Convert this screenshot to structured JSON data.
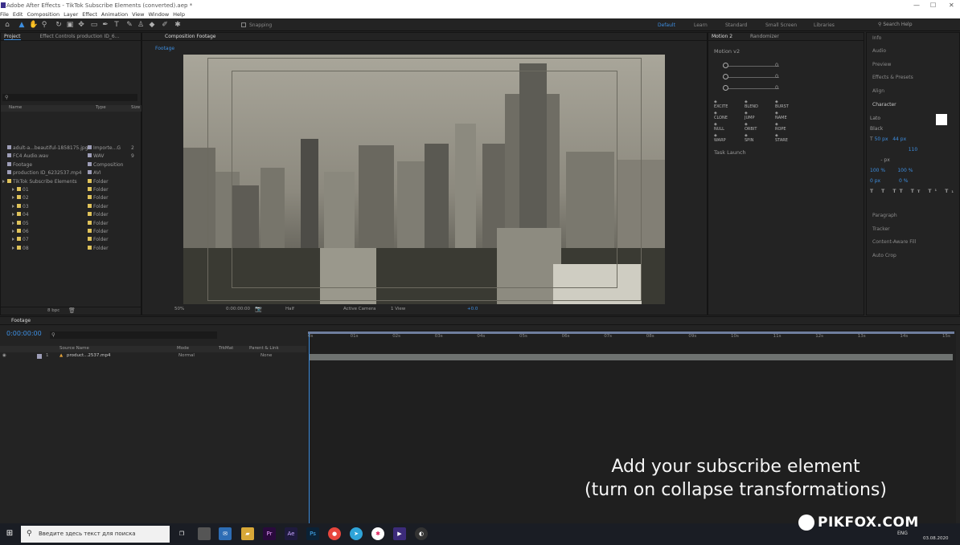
{
  "window": {
    "title": "Adobe After Effects - TikTok Subscribe Elements (converted).aep *"
  },
  "menu": [
    "File",
    "Edit",
    "Composition",
    "Layer",
    "Effect",
    "Animation",
    "View",
    "Window",
    "Help"
  ],
  "toolbar": {
    "snapping": "Snapping",
    "search_help": "Search Help",
    "workspaces": [
      "Default",
      "Learn",
      "Standard",
      "Small Screen",
      "Libraries"
    ]
  },
  "project": {
    "tab": "Project",
    "effect_controls": "Effect Controls production ID_6…",
    "search_placeholder": "",
    "columns": {
      "name": "Name",
      "type": "Type",
      "size": "Size"
    },
    "items": [
      {
        "name": "adult-a...beautiful-1858175.jpg",
        "type": "Importe...G",
        "size": "2",
        "color": "#9e9eb8"
      },
      {
        "name": "FC4 Audio.wav",
        "type": "WAV",
        "size": "9",
        "color": "#9e9eb8"
      },
      {
        "name": "Footage",
        "type": "Composition",
        "size": "",
        "color": "#9e9eb8"
      },
      {
        "name": "production ID_6232537.mp4",
        "type": "AVI",
        "size": "",
        "color": "#9e9eb8"
      },
      {
        "name": "TikTok Subscribe Elements",
        "type": "Folder",
        "size": "",
        "color": "#e0c35a"
      },
      {
        "name": "01",
        "type": "Folder",
        "size": "",
        "color": "#e0c35a"
      },
      {
        "name": "02",
        "type": "Folder",
        "size": "",
        "color": "#e0c35a"
      },
      {
        "name": "03",
        "type": "Folder",
        "size": "",
        "color": "#e0c35a"
      },
      {
        "name": "04",
        "type": "Folder",
        "size": "",
        "color": "#e0c35a"
      },
      {
        "name": "05",
        "type": "Folder",
        "size": "",
        "color": "#e0c35a"
      },
      {
        "name": "06",
        "type": "Folder",
        "size": "",
        "color": "#e0c35a"
      },
      {
        "name": "07",
        "type": "Folder",
        "size": "",
        "color": "#e0c35a"
      },
      {
        "name": "08",
        "type": "Folder",
        "size": "",
        "color": "#e0c35a"
      }
    ],
    "bpc": "8 bpc"
  },
  "composition": {
    "tab": "Composition Footage",
    "subtab": "Footage",
    "zoom": "50%",
    "timecode": "0:00:00:00",
    "resolution": "Half",
    "camera": "Active Camera",
    "views": "1 View",
    "exposure": "+0.0"
  },
  "motion": {
    "tabs": [
      "Motion 2",
      "Randomizer"
    ],
    "preset": "Motion v2",
    "sliders": [
      "0",
      "0",
      "0"
    ],
    "buttons": [
      "EXCITE",
      "BLEND",
      "BURST",
      "CLONE",
      "JUMP",
      "NAME",
      "NULL",
      "ORBIT",
      "ROPE",
      "WARP",
      "SPIN",
      "STARE"
    ],
    "task": "Task Launch"
  },
  "right_panels": {
    "top": [
      "Info",
      "Audio",
      "Preview",
      "Effects & Presets",
      "Align",
      "Character"
    ],
    "char": {
      "font": "Lato",
      "style": "Black",
      "size": "50 px",
      "leading": "44 px",
      "tracking": "110",
      "scale_v": "100 %",
      "scale_h": "100 %",
      "baseline": "0 px",
      "tsume": "0 %",
      "unit": "- px"
    },
    "bottom": [
      "Paragraph",
      "Tracker",
      "Content-Aware Fill",
      "Auto Crop"
    ]
  },
  "timeline": {
    "tab": "Footage",
    "timecode": "0:00:00:00",
    "columns": {
      "source": "Source Name",
      "mode": "Mode",
      "trkmat": "TrkMat",
      "parent": "Parent & Link"
    },
    "layer": {
      "num": "1",
      "name": "product...2537.mp4",
      "mode": "Normal",
      "parent": "None"
    },
    "ruler": [
      "0s",
      "01s",
      "02s",
      "03s",
      "04s",
      "05s",
      "06s",
      "07s",
      "08s",
      "09s",
      "10s",
      "11s",
      "12s",
      "13s",
      "14s",
      "15s"
    ]
  },
  "overlay": {
    "line1": "Add your subscribe element",
    "line2": "(turn on collapse transformations)"
  },
  "watermark": "PIKFOX.COM",
  "taskbar": {
    "search": "Введите здесь текст для поиска",
    "lang": "ENG",
    "date": "03.08.2020"
  }
}
